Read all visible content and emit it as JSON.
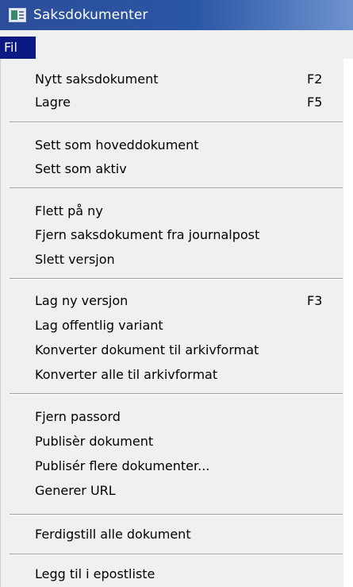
{
  "window": {
    "title": "Saksdokumenter",
    "icon": "app-window-icon"
  },
  "menubar": {
    "items": [
      {
        "label": "Fil",
        "active": true
      }
    ]
  },
  "menu": {
    "groups": [
      [
        {
          "label": "Nytt saksdokument",
          "shortcut": "F2"
        },
        {
          "label": "Lagre",
          "shortcut": "F5"
        }
      ],
      [
        {
          "label": "Sett som hoveddokument"
        },
        {
          "label": "Sett som aktiv"
        }
      ],
      [
        {
          "label": "Flett på ny"
        },
        {
          "label": "Fjern saksdokument fra journalpost"
        },
        {
          "label": "Slett versjon"
        }
      ],
      [
        {
          "label": "Lag ny versjon",
          "shortcut": "F3"
        },
        {
          "label": "Lag offentlig variant"
        },
        {
          "label": "Konverter dokument til arkivformat"
        },
        {
          "label": "Konverter alle til arkivformat"
        }
      ],
      [
        {
          "label": "Fjern passord"
        },
        {
          "label": "Publisèr dokument"
        },
        {
          "label": "Publisér flere dokumenter..."
        },
        {
          "label": "Generer URL"
        }
      ],
      [
        {
          "label": "Ferdigstill alle dokument"
        }
      ],
      [
        {
          "label": "Legg til i epostliste"
        }
      ]
    ]
  },
  "colors": {
    "titlebar_start": "#2c4e9a",
    "titlebar_end": "#6f93cf",
    "menu_highlight": "#0b1a83",
    "menu_background": "#f0f0f0"
  }
}
